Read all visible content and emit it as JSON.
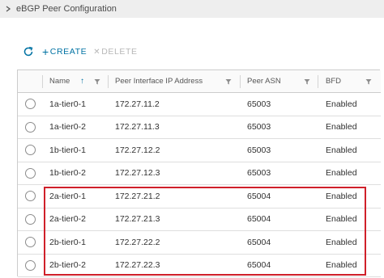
{
  "panel": {
    "title": "eBGP Peer Configuration"
  },
  "toolbar": {
    "create_label": "CREATE",
    "delete_label": "DELETE"
  },
  "columns": {
    "name": "Name",
    "ip": "Peer Interface IP Address",
    "asn": "Peer ASN",
    "bfd": "BFD"
  },
  "rows": [
    {
      "name": "1a-tier0-1",
      "ip": "172.27.11.2",
      "asn": "65003",
      "bfd": "Enabled"
    },
    {
      "name": "1a-tier0-2",
      "ip": "172.27.11.3",
      "asn": "65003",
      "bfd": "Enabled"
    },
    {
      "name": "1b-tier0-1",
      "ip": "172.27.12.2",
      "asn": "65003",
      "bfd": "Enabled"
    },
    {
      "name": "1b-tier0-2",
      "ip": "172.27.12.3",
      "asn": "65003",
      "bfd": "Enabled"
    },
    {
      "name": "2a-tier0-1",
      "ip": "172.27.21.2",
      "asn": "65004",
      "bfd": "Enabled"
    },
    {
      "name": "2a-tier0-2",
      "ip": "172.27.21.3",
      "asn": "65004",
      "bfd": "Enabled"
    },
    {
      "name": "2b-tier0-1",
      "ip": "172.27.22.2",
      "asn": "65004",
      "bfd": "Enabled"
    },
    {
      "name": "2b-tier0-2",
      "ip": "172.27.22.3",
      "asn": "65004",
      "bfd": "Enabled"
    }
  ],
  "colors": {
    "accent": "#0072a3",
    "highlight": "#d0202a",
    "disabled": "#b7b7b7"
  },
  "icons": [
    "chevron-right-icon",
    "refresh-icon",
    "plus-icon",
    "close-icon",
    "sort-up-icon",
    "filter-icon"
  ]
}
